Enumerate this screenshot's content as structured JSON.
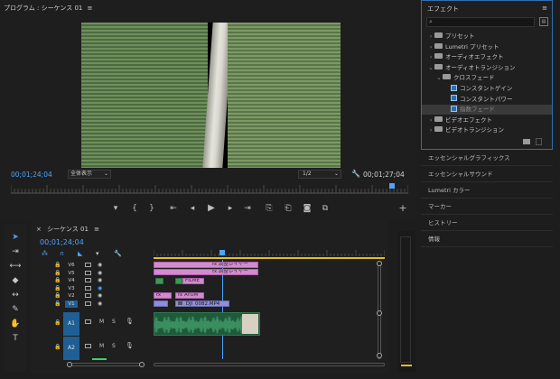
{
  "program": {
    "title": "プログラム : シーケンス 01",
    "menu_icon": "≡",
    "timecode_current": "00;01;24;04",
    "fit_label": "全体表示",
    "resolution": "1/2",
    "timecode_total": "00;01;27;04",
    "playhead_fraction": 0.96
  },
  "effects": {
    "title": "エフェクト",
    "menu_icon": "≡",
    "items": [
      {
        "label": "プリセット",
        "type": "folder",
        "indent": 0,
        "arrow": "›"
      },
      {
        "label": "Lumetri プリセット",
        "type": "folder",
        "indent": 0,
        "arrow": "›"
      },
      {
        "label": "オーディオエフェクト",
        "type": "folder",
        "indent": 0,
        "arrow": "›"
      },
      {
        "label": "オーディオトランジション",
        "type": "folder",
        "indent": 0,
        "arrow": "⌄"
      },
      {
        "label": "クロスフェード",
        "type": "folder",
        "indent": 1,
        "arrow": "⌄"
      },
      {
        "label": "コンスタントゲイン",
        "type": "fx",
        "indent": 2,
        "arrow": ""
      },
      {
        "label": "コンスタントパワー",
        "type": "fx",
        "indent": 2,
        "arrow": ""
      },
      {
        "label": "指数フェード",
        "type": "fx",
        "indent": 2,
        "arrow": "",
        "selected": true
      },
      {
        "label": "ビデオエフェクト",
        "type": "folder",
        "indent": 0,
        "arrow": "›"
      },
      {
        "label": "ビデオトランジション",
        "type": "folder",
        "indent": 0,
        "arrow": "›"
      }
    ]
  },
  "side_panels": [
    "エッセンシャルグラフィックス",
    "エッセンシャルサウンド",
    "Lumetri カラー",
    "マーカー",
    "ヒストリー",
    "情報"
  ],
  "timeline": {
    "close": "×",
    "title": "シーケンス 01",
    "menu_icon": "≡",
    "timecode": "00;01;24;04",
    "video_tracks": [
      "V6",
      "V5",
      "V4",
      "V3",
      "V2",
      "V1"
    ],
    "audio_tracks": [
      "A1",
      "A2"
    ],
    "audio_toggles": [
      "M",
      "S"
    ],
    "clips": {
      "v6_label": "調整レイヤー",
      "v5_label": "調整レイヤー",
      "v4_label": "FILME",
      "v2_label": "AYUM",
      "v1_label": "DJI_0082.MP4",
      "fx_badge": "fx"
    }
  },
  "colors": {
    "accent": "#4ea3ff",
    "pink_clip": "#d38bd0",
    "purple_clip": "#8f8fd8",
    "green_clip": "#3a9a55",
    "audio_clip": "#1f5a3a",
    "active_track": "#1f5f93"
  }
}
